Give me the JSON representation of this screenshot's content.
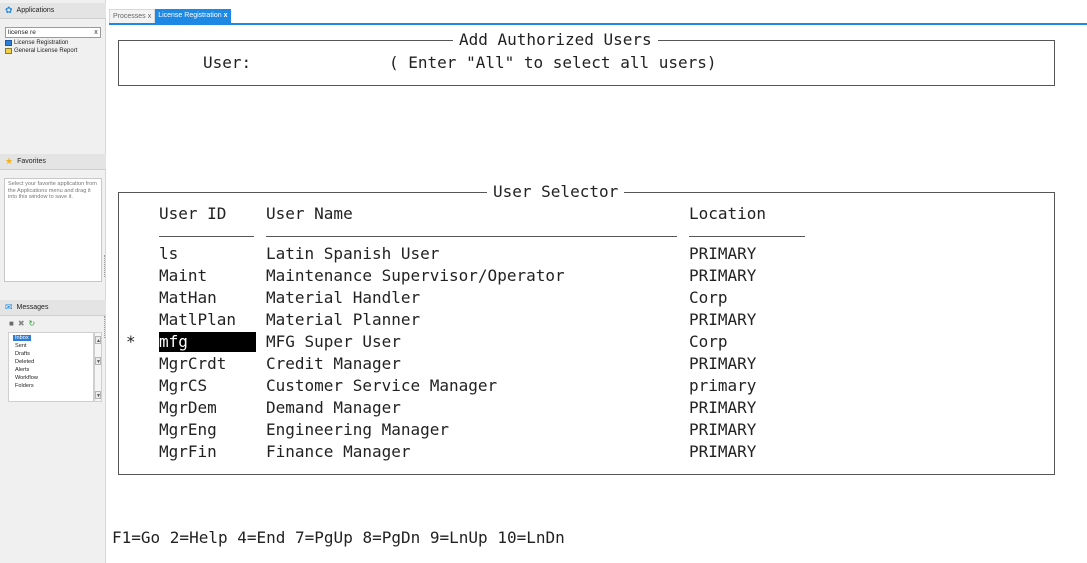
{
  "sidebar": {
    "applications": {
      "title": "Applications",
      "search_value": "license re",
      "clear_glyph": "x",
      "items": [
        {
          "label": "License Registration"
        },
        {
          "label": "General License Report"
        }
      ]
    },
    "favorites": {
      "title": "Favorites",
      "help_text": "Select your favorite application from the Applications menu and drag it into this window to save it."
    },
    "messages": {
      "title": "Messages",
      "folders": [
        "Inbox",
        "Sent",
        "Drafts",
        "Deleted",
        "Alerts",
        "Workflow",
        "Folders"
      ],
      "selected": "Inbox"
    }
  },
  "tabs": [
    {
      "label": "Processes",
      "close": "x",
      "active": false
    },
    {
      "label": "License Registration",
      "close": "x",
      "active": true
    }
  ],
  "screen": {
    "add_section": {
      "title": "Add Authorized Users",
      "user_label": "User:",
      "user_hint": "( Enter \"All\" to select all users)"
    },
    "selector": {
      "title": "User Selector",
      "headers": {
        "user_id": "User ID",
        "user_name": "User Name",
        "location": "Location"
      },
      "rows": [
        {
          "mark": "",
          "id": "ls",
          "name": "Latin Spanish User",
          "location": "PRIMARY"
        },
        {
          "mark": "",
          "id": "Maint",
          "name": "Maintenance Supervisor/Operator",
          "location": "PRIMARY"
        },
        {
          "mark": "",
          "id": "MatHan",
          "name": "Material Handler",
          "location": "Corp"
        },
        {
          "mark": "",
          "id": "MatlPlan",
          "name": "Material Planner",
          "location": "PRIMARY"
        },
        {
          "mark": "*",
          "id": "mfg",
          "name": "MFG Super User",
          "location": "Corp"
        },
        {
          "mark": "",
          "id": "MgrCrdt",
          "name": "Credit Manager",
          "location": "PRIMARY"
        },
        {
          "mark": "",
          "id": "MgrCS",
          "name": "Customer Service Manager",
          "location": "primary"
        },
        {
          "mark": "",
          "id": "MgrDem",
          "name": "Demand Manager",
          "location": "PRIMARY"
        },
        {
          "mark": "",
          "id": "MgrEng",
          "name": "Engineering Manager",
          "location": "PRIMARY"
        },
        {
          "mark": "",
          "id": "MgrFin",
          "name": "Finance Manager",
          "location": "PRIMARY"
        }
      ],
      "highlighted_row": 4
    },
    "function_keys": "F1=Go 2=Help 4=End 7=PgUp 8=PgDn 9=LnUp 10=LnDn"
  },
  "colors": {
    "tab_active": "#1e88e5",
    "selection": "#000000",
    "inbox_selected": "#2e7dd7"
  }
}
